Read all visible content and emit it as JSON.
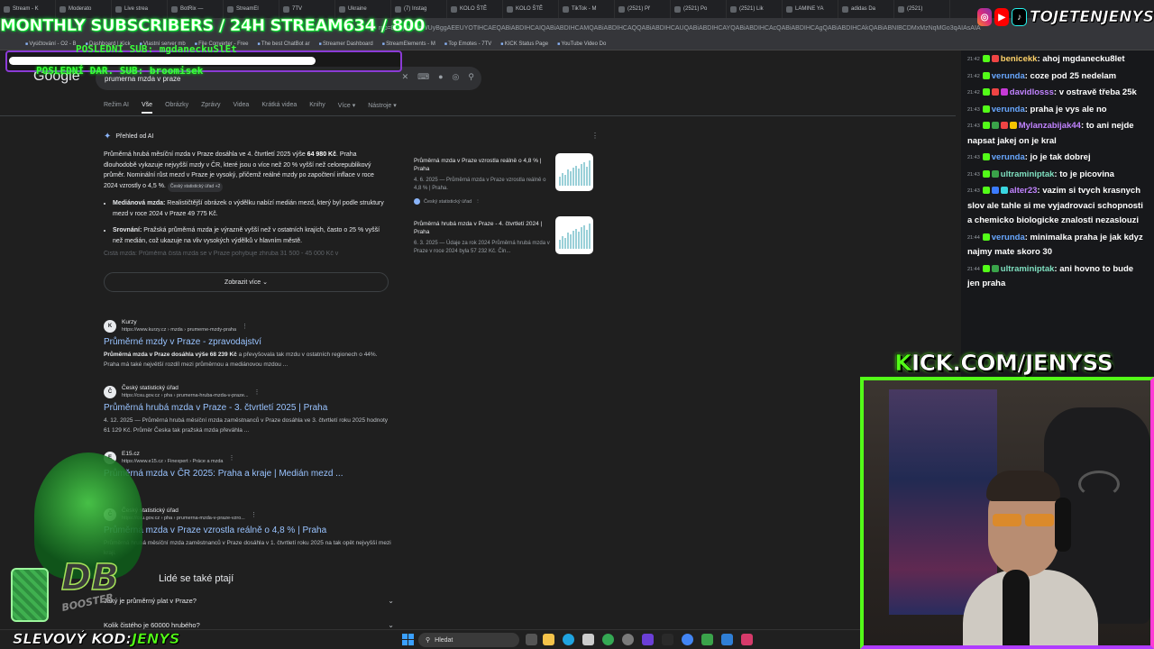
{
  "browser": {
    "tabs": [
      "Stream - K",
      "Moderato",
      "Live strea",
      "BotRix —",
      "StreamEl",
      "7TV",
      "Ukraine",
      "(7) Instag",
      "KOLO ŠTĚ",
      "KOLO ŠTĚ",
      "TikTok - M",
      "(2521) Př",
      "(2521) Po",
      "(2521) Lik",
      "LAMINE YA",
      "adidas Da",
      "(2521)"
    ],
    "address": "rcp=EgZjaHJvbWUyBggAEEUYOTIHCAEQABiABDIHCAIQABiABDIHCAMQABiABDIHCAQQABiABDIHCAUQABiABDIHCAYQABiABDIHCAcQABiABDIHCAgQABiABDIHCAkQABiABNIBCDMxMzNqMGo3qAIAsAIA",
    "bookmarks": [
      "Vyúčtování - O2 - B",
      "Dashboard | Kick",
      "Vlastní server mb",
      "File Converter - Free",
      "The best ChatBot ar",
      "Streamer Dashboard",
      "StreamElements - M",
      "Top Emotes - 7TV",
      "KICK Status Page",
      "YouTube Video Do"
    ]
  },
  "overlay": {
    "banner": "MONTHLY SUBSCRIBERS / 24H STREAM634 / 800",
    "last_sub": "POSLEDNÍ SUB: mgdaneckuSlEt",
    "last_dar": "POSLEDNÍ DAR. SUB: broomisek",
    "social_handle": "TOJETENJENYS",
    "kick_prefix": "K",
    "kick_url": "ICK.COM/JENYSS",
    "discount_prefix": "SLEVOVÝ KOD:",
    "discount_code": "JENYS",
    "booster_logo": "DB",
    "booster_text": "BOOSTER"
  },
  "google": {
    "logo": "Google",
    "query": "prumerna mzda v praze",
    "tabs": [
      "Režim AI",
      "Vše",
      "Obrázky",
      "Zprávy",
      "Videa",
      "Krátká videa",
      "Knihy",
      "Více ▾",
      "Nástroje ▾"
    ],
    "ai_label": "Přehled od AI",
    "ai_p1_a": "Průměrná hrubá měsíční mzda v Praze dosáhla ve 4. čtvrtletí 2025 výše ",
    "ai_p1_b": "64 980 Kč",
    "ai_p1_c": ". Praha dlouhodobě vykazuje nejvyšší mzdy v ČR, které jsou o více než 20 % vyšší než celorepublikový průměr. Nominální růst mezd v Praze je vysoký, přičemž reálné mzdy po započtení inflace v roce 2024 vzrostly o 4,5 %.",
    "ai_chip": "Český statistický úřad +2",
    "ai_b1_h": "Mediánová mzda:",
    "ai_b1_t": " Realističtější obrázek o výdělku nabízí medián mezd, který byl podle struktury mezd v roce 2024 v Praze 49 775 Kč.",
    "ai_b2_h": "Srovnání:",
    "ai_b2_t": " Pražská průměrná mzda je výrazně vyšší než v ostatních krajích, často o 25 % vyšší než medián, což ukazuje na vliv vysokých výdělků v hlavním městě.",
    "ai_fade": "Čistá mzda: Průměrná čistá mzda se v Praze pohybuje zhruba 31 500 - 45 000 Kč v",
    "ai_more": "Zobrazit více",
    "sources": [
      {
        "title": "Průměrná mzda v Praze vzrostla reálně o 4,8 % | Praha",
        "meta": "4. 6. 2025 — Průměrná mzda v Praze vzrostla reálně o 4,8 % | Praha.",
        "pub": "Český statistický úřad"
      },
      {
        "title": "Průměrná hrubá mzda v Praze - 4. čtvrtletí 2024 | Praha",
        "meta": "6. 3. 2025 — Údaje za rok 2024 Průměrná hrubá mzda v Praze v roce 2024 byla 57 232 Kč. Čin...",
        "pub": ""
      }
    ],
    "results": [
      {
        "fav": "K",
        "site": "Kurzy",
        "url": "https://www.kurzy.cz › mzda › prumerne-mzdy-praha",
        "title": "Průměrné mzdy v Praze - zpravodajství",
        "snip_b": "Průměrná mzda v Praze dosáhla výše 68 239 Kč",
        "snip": " a převyšovala tak mzdu v ostatních regionech o 44%. Praha má také největší rozdíl mezi průměrnou a mediánovou mzdou ..."
      },
      {
        "fav": "Č",
        "site": "Český statistický úřad",
        "url": "https://csu.gov.cz › pha › prumerna-hruba-mzda-v-praze...",
        "title": "Průměrná hrubá mzda v Praze - 3. čtvrtletí 2025 | Praha",
        "snip_b": "",
        "snip": "4. 12. 2025 — Průměrná hrubá měsíční mzda zaměstnanců v Praze dosáhla ve 3. čtvrtletí roku 2025 hodnoty 61 129 Kč. Průměr Česka tak pražská mzda převáhla ..."
      },
      {
        "fav": "E",
        "site": "E15.cz",
        "url": "https://www.e15.cz › Finexpert › Práce a mzda",
        "title": "Průměrná mzda v ČR 2025: Praha a kraje | Medián mezd ...",
        "snip_b": "",
        "snip": ""
      },
      {
        "fav": "Č",
        "site": "Český statistický úřad",
        "url": "https://csu.gov.cz › pha › prumerna-mzda-v-praze-vzro...",
        "title": "Průměrná mzda v Praze vzrostla reálně o 4,8 % | Praha",
        "snip_b": "",
        "snip": "Průměrná hrubá měsíční mzda zaměstnanců v Praze dosáhla v 1. čtvrtletí roku 2025 na tak opět nejvyšší mezi kraji."
      }
    ],
    "paa_title": "Lidé se také ptají",
    "paa": [
      "Jaký je průměrný plat v Praze?",
      "Kolik čistého je 60000 hrubého?"
    ]
  },
  "chat": [
    {
      "ts": "21:42",
      "badges": [
        "#53fc18",
        "#e44"
      ],
      "user": "benicekk",
      "color": "#ffd36a",
      "text": "ahoj mgdanecku8let"
    },
    {
      "ts": "21:42",
      "badges": [
        "#53fc18"
      ],
      "user": "verunda",
      "color": "#68a7ff",
      "text": "coze pod 25 nedelam"
    },
    {
      "ts": "21:42",
      "badges": [
        "#53fc18",
        "#e44",
        "#c63ad6"
      ],
      "user": "davidlosss",
      "color": "#c183ff",
      "text": "v ostravě třeba 25k"
    },
    {
      "ts": "21:43",
      "badges": [
        "#53fc18"
      ],
      "user": "verunda",
      "color": "#68a7ff",
      "text": "praha je vys ale no"
    },
    {
      "ts": "21:43",
      "badges": [
        "#53fc18",
        "#3aa34a",
        "#e44",
        "#f5c400"
      ],
      "user": "Mylanzabijak44",
      "color": "#c183ff",
      "text": "to ani nejde napsat jakej on je kral"
    },
    {
      "ts": "21:43",
      "badges": [
        "#53fc18"
      ],
      "user": "verunda",
      "color": "#68a7ff",
      "text": "jo je tak dobrej"
    },
    {
      "ts": "21:43",
      "badges": [
        "#53fc18",
        "#3aa34a"
      ],
      "user": "ultraminiptak",
      "color": "#7fe0c0",
      "text": "to je picovina"
    },
    {
      "ts": "21:43",
      "badges": [
        "#53fc18",
        "#3b7bff",
        "#3ad6e0"
      ],
      "user": "alter23",
      "color": "#c183ff",
      "text": "vazim si tvych krasnych slov ale tahle si me vyjadrovaci schopnosti a chemicko biologicke znalosti nezaslouzi"
    },
    {
      "ts": "21:44",
      "badges": [
        "#53fc18"
      ],
      "user": "verunda",
      "color": "#68a7ff",
      "text": "minimalka praha je jak kdyz najmy mate skoro 30"
    },
    {
      "ts": "21:44",
      "badges": [
        "#53fc18",
        "#3aa34a"
      ],
      "user": "ultraminiptak",
      "color": "#7fe0c0",
      "text": "ani hovno to bude jen praha"
    }
  ],
  "taskbar": {
    "search": "Hledat"
  }
}
